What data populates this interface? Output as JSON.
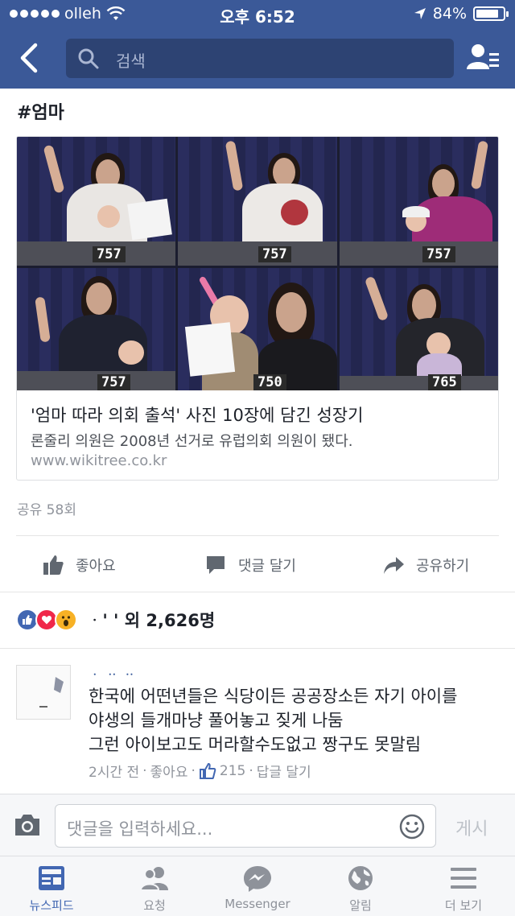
{
  "status_bar": {
    "carrier": "olleh",
    "time": "오후 6:52",
    "battery": "84%",
    "battery_level": 0.84
  },
  "header": {
    "search_placeholder": "검색"
  },
  "post": {
    "hashtag": "#엄마"
  },
  "link_card": {
    "photo_seat_numbers": [
      "757",
      "757",
      "757",
      "757",
      "750",
      "765"
    ],
    "title": "'엄마 따라 의회 출석' 사진 10장에 담긴 성장기",
    "description": "론줄리 의원은 2008년 선거로 유럽의회 의원이 됐다.",
    "domain": "www.wikitree.co.kr"
  },
  "shares": "공유 58회",
  "actions": {
    "like": "좋아요",
    "comment": "댓글 달기",
    "share": "공유하기"
  },
  "reactions": {
    "icons": [
      "like-icon",
      "love-icon",
      "wow-icon"
    ],
    "summary": "ᆞ'    ' 외 2,626명"
  },
  "comment": {
    "author": "ᆞ ᆢ ᆢ",
    "lines": [
      "한국에 어떤년들은 식당이든 공공장소든 자기 아이를",
      "야생의 들개마냥 풀어놓고 짖게 나둠",
      "그런 아이보고도 머라할수도없고 짱구도 못말림"
    ],
    "time": "2시간 전",
    "like_label": "좋아요",
    "like_count": "215",
    "reply_label": "답글 달기"
  },
  "composer": {
    "placeholder": "댓글을 입력하세요...",
    "post_label": "게시"
  },
  "tabbar": {
    "tabs": [
      {
        "label": "뉴스피드",
        "icon": "news-feed-icon"
      },
      {
        "label": "요청",
        "icon": "friend-requests-icon"
      },
      {
        "label": "Messenger",
        "icon": "messenger-icon"
      },
      {
        "label": "알림",
        "icon": "notifications-globe-icon"
      },
      {
        "label": "더 보기",
        "icon": "more-menu-icon"
      }
    ]
  },
  "colors": {
    "brand": "#3b5998",
    "accent": "#4267b2",
    "meta": "#90949c"
  }
}
